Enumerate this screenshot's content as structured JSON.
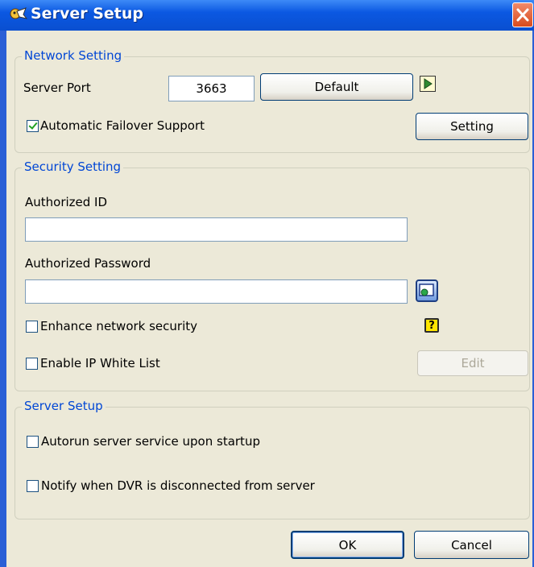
{
  "window": {
    "title": "Server Setup"
  },
  "network": {
    "legend": "Network Setting",
    "server_port_label": "Server Port",
    "server_port_value": "3663",
    "default_button": "Default",
    "failover_label": "Automatic Failover Support",
    "failover_checked": true,
    "setting_button": "Setting"
  },
  "security": {
    "legend": "Security Setting",
    "authorized_id_label": "Authorized ID",
    "authorized_id_value": "",
    "authorized_password_label": "Authorized Password",
    "authorized_password_value": "",
    "enhance_label": "Enhance network security",
    "enhance_checked": false,
    "ip_whitelist_label": "Enable IP White List",
    "ip_whitelist_checked": false,
    "edit_button": "Edit"
  },
  "server_setup": {
    "legend": "Server Setup",
    "autorun_label": "Autorun server service upon startup",
    "autorun_checked": false,
    "notify_label": "Notify when DVR is disconnected from server",
    "notify_checked": false
  },
  "footer": {
    "ok_button": "OK",
    "cancel_button": "Cancel"
  },
  "icons": {
    "app": "app-icon",
    "close": "close-icon",
    "arrow": "play-arrow-icon",
    "password": "password-tool-icon",
    "help": "help-question-icon"
  },
  "colors": {
    "titlebar": "#0b58e2",
    "legend": "#0046d5",
    "dialog": "#ece9d8"
  }
}
